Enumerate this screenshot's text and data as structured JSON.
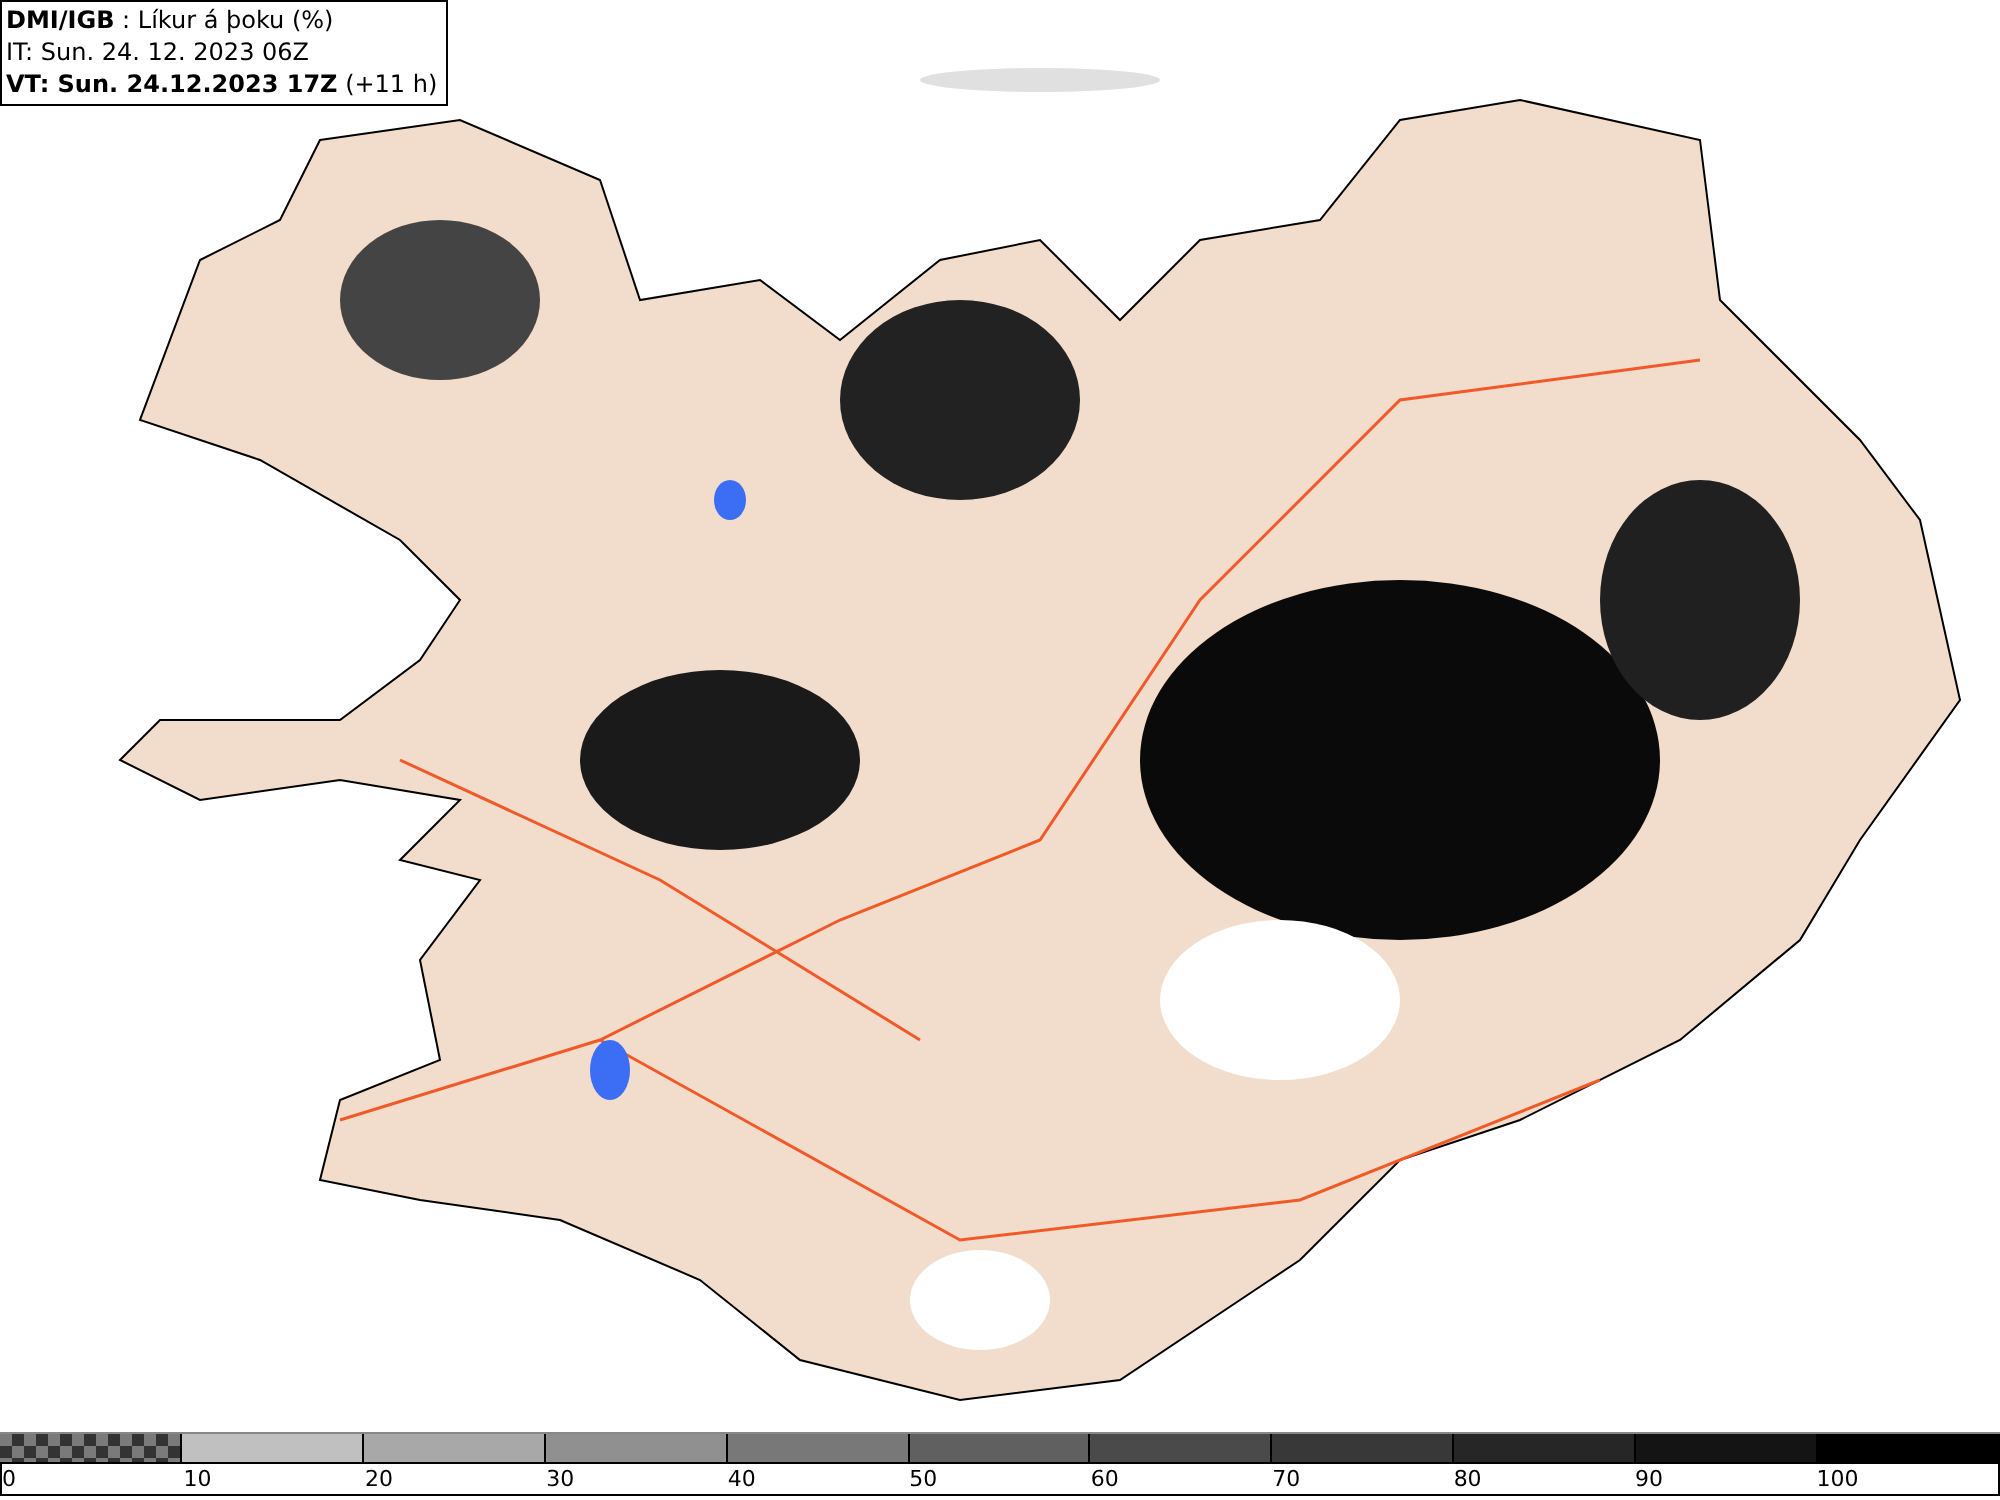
{
  "header": {
    "source": "DMI/IGB",
    "title": " : Líkur á þoku (%)",
    "issue_time": "IT: Sun. 24. 12. 2023 06Z",
    "valid_time_label": "VT: Sun. 24.12.2023 17Z",
    "valid_offset": " (+11 h)"
  },
  "legend": [
    {
      "label": "0",
      "kind": "checker",
      "color": "#7a7a7a"
    },
    {
      "label": "10",
      "kind": "solid",
      "color": "#c0c0c0"
    },
    {
      "label": "20",
      "kind": "solid",
      "color": "#a8a8a8"
    },
    {
      "label": "30",
      "kind": "solid",
      "color": "#909090"
    },
    {
      "label": "40",
      "kind": "solid",
      "color": "#787878"
    },
    {
      "label": "50",
      "kind": "solid",
      "color": "#606060"
    },
    {
      "label": "60",
      "kind": "solid",
      "color": "#4a4a4a"
    },
    {
      "label": "70",
      "kind": "solid",
      "color": "#383838"
    },
    {
      "label": "80",
      "kind": "solid",
      "color": "#262626"
    },
    {
      "label": "90",
      "kind": "solid",
      "color": "#141414"
    },
    {
      "label": "100",
      "kind": "solid",
      "color": "#000000"
    }
  ]
}
